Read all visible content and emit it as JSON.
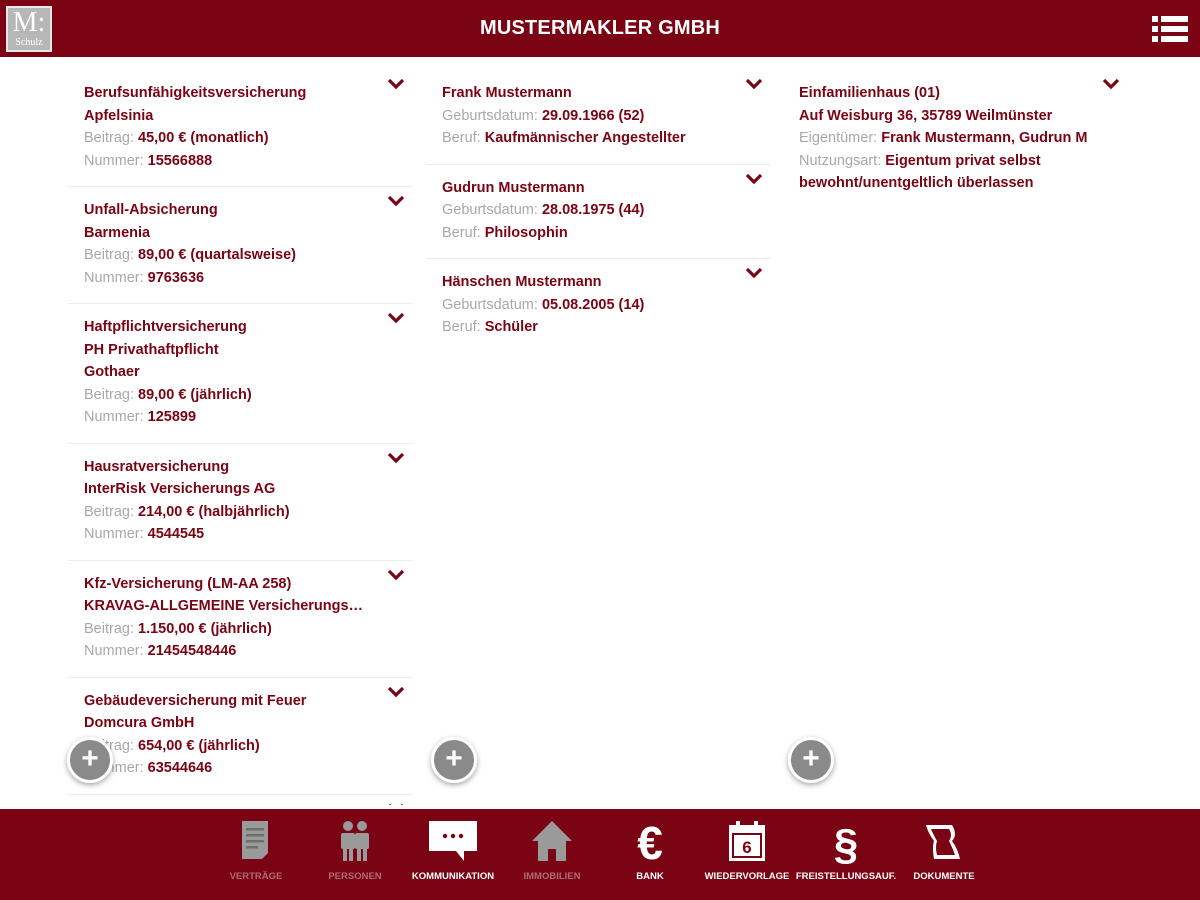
{
  "header": {
    "logo_text": "M:",
    "logo_subtext": "Schulz",
    "title": "MUSTERMAKLER GMBH"
  },
  "contracts": [
    {
      "lines": [
        "Berufsunfähigkeitsversicherung",
        "Apfelsinia"
      ],
      "beitrag_label": "Beitrag:",
      "beitrag": "45,00 € (monatlich)",
      "nummer_label": "Nummer:",
      "nummer": "15566888"
    },
    {
      "lines": [
        "Unfall-Absicherung",
        "Barmenia"
      ],
      "beitrag_label": "Beitrag:",
      "beitrag": "89,00 € (quartalsweise)",
      "nummer_label": "Nummer:",
      "nummer": "9763636"
    },
    {
      "lines": [
        "Haftpflichtversicherung",
        "PH Privathaftpflicht",
        "Gothaer"
      ],
      "beitrag_label": "Beitrag:",
      "beitrag": "89,00 € (jährlich)",
      "nummer_label": "Nummer:",
      "nummer": "125899"
    },
    {
      "lines": [
        "Hausratversicherung",
        "InterRisk Versicherungs AG"
      ],
      "beitrag_label": "Beitrag:",
      "beitrag": "214,00 € (halbjährlich)",
      "nummer_label": "Nummer:",
      "nummer": "4544545"
    },
    {
      "lines": [
        "Kfz-Versicherung (LM-AA 258)",
        "KRAVAG-ALLGEMEINE VersicherungsAkti ..."
      ],
      "beitrag_label": "Beitrag:",
      "beitrag": "1.150,00 € (jährlich)",
      "nummer_label": "Nummer:",
      "nummer": "21454548446"
    },
    {
      "lines": [
        "Gebäudeversicherung mit Feuer",
        "Domcura GmbH"
      ],
      "beitrag_label": "Beitrag:",
      "beitrag": "654,00 € (jährlich)",
      "nummer_label": "Nummer:",
      "nummer": "63544646"
    }
  ],
  "persons": [
    {
      "name": "Frank Mustermann",
      "geburt_label": "Geburtsdatum:",
      "geburt": "29.09.1966 (52)",
      "beruf_label": "Beruf:",
      "beruf": "Kaufmännischer Angestellter"
    },
    {
      "name": "Gudrun Mustermann",
      "geburt_label": "Geburtsdatum:",
      "geburt": "28.08.1975 (44)",
      "beruf_label": "Beruf:",
      "beruf": "Philosophin"
    },
    {
      "name": "Hänschen Mustermann",
      "geburt_label": "Geburtsdatum:",
      "geburt": "05.08.2005 (14)",
      "beruf_label": "Beruf:",
      "beruf": "Schüler"
    }
  ],
  "properties": [
    {
      "title": "Einfamilienhaus (01)",
      "address": "Auf Weisburg 36, 35789 Weilmünster",
      "owner_label": "Eigentümer:",
      "owner": "Frank Mustermann, Gudrun Musterma",
      "usage_label": "Nutzungsart:",
      "usage": "Eigentum privat selbst bewohnt/unentgeltlich überlassen"
    }
  ],
  "add_buttons": {
    "symbol": "+"
  },
  "bottom_nav": [
    {
      "label": "VERTRÄGE",
      "icon": "document-icon",
      "active": false
    },
    {
      "label": "PERSONEN",
      "icon": "people-icon",
      "active": false
    },
    {
      "label": "KOMMUNIKATION",
      "icon": "chat-bubble-icon",
      "active": true
    },
    {
      "label": "IMMOBILIEN",
      "icon": "house-icon",
      "active": false
    },
    {
      "label": "BANK",
      "icon": "euro-icon",
      "active": true
    },
    {
      "label": "WIEDERVORLAGE",
      "icon": "calendar-icon",
      "active": true
    },
    {
      "label": "FREISTELLUNGSAUF.",
      "icon": "paragraph-icon",
      "active": true
    },
    {
      "label": "DOKUMENTE",
      "icon": "scroll-icon",
      "active": true
    }
  ],
  "colors": {
    "brand": "#7a0413",
    "label_grey": "#a8a8a8",
    "fab": "#8a8a8a",
    "inactive_nav": "#b06a74"
  }
}
